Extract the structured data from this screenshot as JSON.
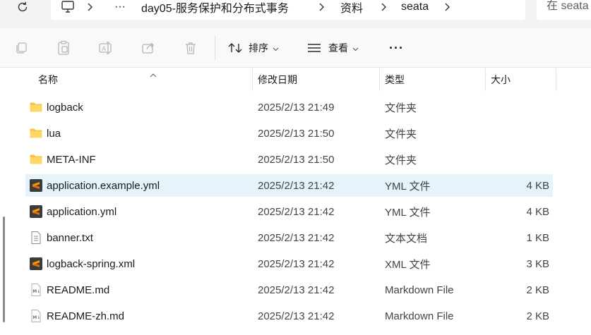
{
  "address_bar": {
    "refresh_icon": "refresh-icon",
    "breadcrumb": {
      "overflow": "···",
      "items": [
        "day05-服务保护和分布式事务",
        "资料",
        "seata"
      ]
    },
    "search_placeholder": "在 seata"
  },
  "toolbar": {
    "sort_label": "排序",
    "view_label": "查看",
    "more_label": "···",
    "icons": [
      "copy-icon",
      "paste-icon",
      "rename-icon",
      "share-icon",
      "delete-icon"
    ]
  },
  "columns": {
    "name": "名称",
    "date": "修改日期",
    "type": "类型",
    "size": "大小"
  },
  "colors": {
    "folder": "#f6c342",
    "sublime": "#3b3b3b",
    "selected_row": "#e5f3fb"
  },
  "files": [
    {
      "name": "logback",
      "date": "2025/2/13 21:49",
      "type": "文件夹",
      "size": "",
      "icon": "folder-icon"
    },
    {
      "name": "lua",
      "date": "2025/2/13 21:50",
      "type": "文件夹",
      "size": "",
      "icon": "folder-icon"
    },
    {
      "name": "META-INF",
      "date": "2025/2/13 21:50",
      "type": "文件夹",
      "size": "",
      "icon": "folder-icon"
    },
    {
      "name": "application.example.yml",
      "date": "2025/2/13 21:42",
      "type": "YML 文件",
      "size": "4 KB",
      "icon": "sublime-file-icon",
      "selected": true
    },
    {
      "name": "application.yml",
      "date": "2025/2/13 21:42",
      "type": "YML 文件",
      "size": "4 KB",
      "icon": "sublime-file-icon"
    },
    {
      "name": "banner.txt",
      "date": "2025/2/13 21:42",
      "type": "文本文档",
      "size": "1 KB",
      "icon": "text-file-icon"
    },
    {
      "name": "logback-spring.xml",
      "date": "2025/2/13 21:42",
      "type": "XML 文件",
      "size": "3 KB",
      "icon": "sublime-file-icon"
    },
    {
      "name": "README.md",
      "date": "2025/2/13 21:42",
      "type": "Markdown File",
      "size": "2 KB",
      "icon": "markdown-file-icon"
    },
    {
      "name": "README-zh.md",
      "date": "2025/2/13 21:42",
      "type": "Markdown File",
      "size": "2 KB",
      "icon": "markdown-file-icon"
    }
  ]
}
